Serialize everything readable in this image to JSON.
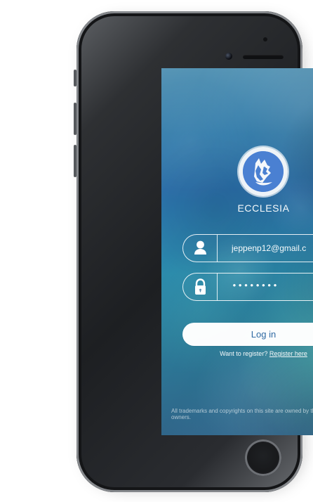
{
  "app": {
    "name": "ECCLESIA"
  },
  "login_form": {
    "email_value": "jeppenp12@gmail.c",
    "password_value": "••••••••",
    "login_button_label": "Log in",
    "register_prompt": "Want to register?",
    "register_link": "Register here"
  },
  "footer": {
    "notice": "All trademarks and copyrights on this site are owned by their respective owners."
  },
  "icons": {
    "user": "user-icon",
    "lock": "lock-icon",
    "check": "check-icon",
    "logo": "wolf-logo-icon"
  },
  "colors": {
    "accent": "#2f6aa3",
    "valid_check": "#73e06b",
    "logo_blue": "#4a80d2"
  }
}
